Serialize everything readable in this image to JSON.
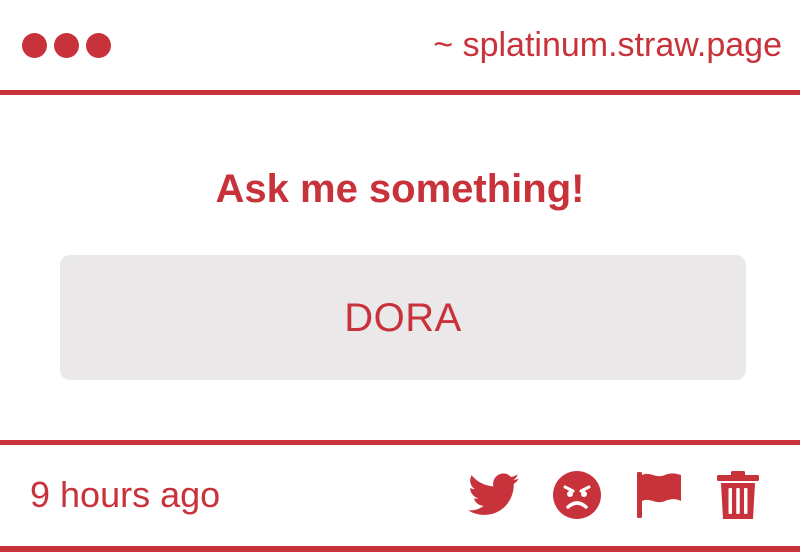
{
  "window": {
    "url": "~ splatinum.straw.page"
  },
  "post": {
    "question": "Ask me something!",
    "answer": "DORA"
  },
  "footer": {
    "timestamp": "9 hours ago",
    "actions": [
      {
        "name": "twitter-icon"
      },
      {
        "name": "angry-face-icon"
      },
      {
        "name": "flag-icon"
      },
      {
        "name": "trash-icon"
      }
    ]
  },
  "colors": {
    "accent": "#c8323a",
    "answer_bg": "#ebe8e9",
    "background": "#ffffff"
  }
}
